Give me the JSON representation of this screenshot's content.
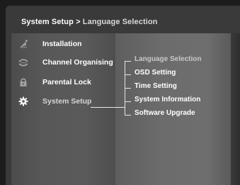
{
  "header": {
    "title": "System Setup",
    "separator": ">",
    "subtitle": "Language Selection"
  },
  "main_menu": {
    "items": [
      {
        "label": "Installation",
        "icon": "satellite-dish-icon"
      },
      {
        "label": "Channel Organising",
        "icon": "channel-organise-icon"
      },
      {
        "label": "Parental Lock",
        "icon": "padlock-icon"
      },
      {
        "label": "System Setup",
        "icon": "gear-icon",
        "active": true
      }
    ]
  },
  "submenu": {
    "items": [
      {
        "label": "Language Selection",
        "current": true
      },
      {
        "label": "OSD Setting"
      },
      {
        "label": "Time Setting"
      },
      {
        "label": "System Information"
      },
      {
        "label": "Software Upgrade"
      }
    ]
  },
  "colors": {
    "background": "#1c1c1c",
    "frame": "#3a3a3a",
    "text": "#ffffff",
    "dim_text": "#c8c8c8",
    "line": "#e6e6e6"
  }
}
